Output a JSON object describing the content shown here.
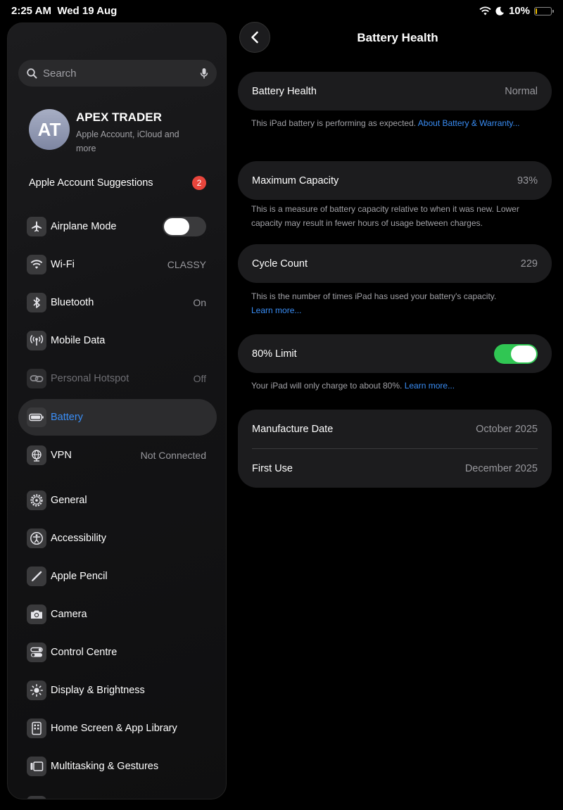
{
  "status_bar": {
    "time": "2:25 AM",
    "date": "Wed 19 Aug",
    "battery": "10%",
    "battery_level": 0.1
  },
  "sidebar": {
    "search_placeholder": "Search",
    "profile": {
      "initials": "AT",
      "name": "APEX TRADER",
      "subtitle": "Apple Account, iCloud and more"
    },
    "suggestions": {
      "label": "Apple Account Suggestions",
      "count": "2"
    },
    "items": [
      {
        "label": "Airplane Mode",
        "value": "",
        "icon": "airplane-icon"
      },
      {
        "label": "Wi-Fi",
        "value": "CLASSY",
        "icon": "wifi-icon"
      },
      {
        "label": "Bluetooth",
        "value": "On",
        "icon": "bluetooth-icon"
      },
      {
        "label": "Mobile Data",
        "value": "",
        "icon": "antenna-icon"
      },
      {
        "label": "Personal Hotspot",
        "value": "Off",
        "icon": "link-icon"
      },
      {
        "label": "Battery",
        "value": "",
        "icon": "battery-icon"
      },
      {
        "label": "VPN",
        "value": "Not Connected",
        "icon": "globe-icon"
      },
      {
        "label": "General",
        "value": "",
        "icon": "gear-icon"
      },
      {
        "label": "Accessibility",
        "value": "",
        "icon": "accessibility-icon"
      },
      {
        "label": "Apple Pencil",
        "value": "",
        "icon": "pencil-icon"
      },
      {
        "label": "Camera",
        "value": "",
        "icon": "camera-icon"
      },
      {
        "label": "Control Centre",
        "value": "",
        "icon": "switches-icon"
      },
      {
        "label": "Display & Brightness",
        "value": "",
        "icon": "sun-icon"
      },
      {
        "label": "Home Screen & App Library",
        "value": "",
        "icon": "phone-grid-icon"
      },
      {
        "label": "Multitasking & Gestures",
        "value": "",
        "icon": "multitask-icon"
      }
    ]
  },
  "detail": {
    "title": "Battery Health",
    "health": {
      "label": "Battery Health",
      "value": "Normal"
    },
    "health_note": "This iPad battery is performing as expected. ",
    "health_link": "About Battery & Warranty...",
    "capacity": {
      "label": "Maximum Capacity",
      "value": "93%"
    },
    "capacity_note": "This is a measure of battery capacity relative to when it was new. Lower capacity may result in fewer hours of usage between charges.",
    "cycles": {
      "label": "Cycle Count",
      "value": "229"
    },
    "cycles_note": "This is the number of times iPad has used your battery's capacity.",
    "cycles_link": "Learn more...",
    "limit": {
      "label": "80% Limit",
      "enabled": true
    },
    "limit_note": "Your iPad will only charge to about 80%. ",
    "limit_link": "Learn more...",
    "manufacture": {
      "label": "Manufacture Date",
      "value": "October 2025"
    },
    "first_use": {
      "label": "First Use",
      "value": "December 2025"
    }
  }
}
